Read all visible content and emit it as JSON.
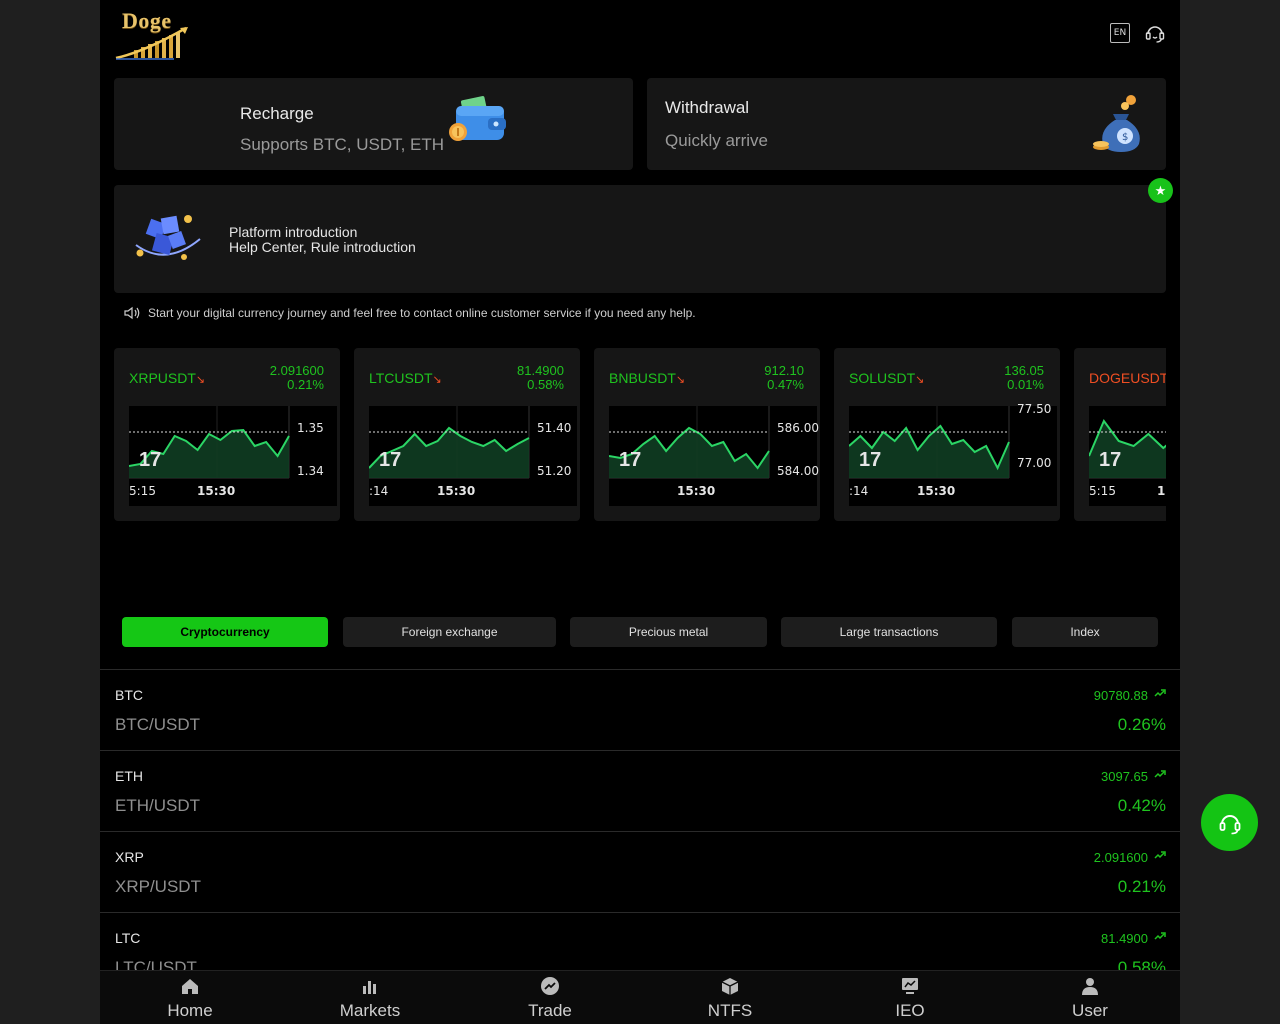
{
  "header": {
    "logo_text": "Doge",
    "language_label": "EN",
    "colors": {
      "accent": "#15c715",
      "down": "#ef4e23",
      "background": "#000000"
    }
  },
  "cards": {
    "recharge": {
      "title": "Recharge",
      "subtitle": "Supports BTC, USDT, ETH",
      "icon": "wallet-icon"
    },
    "withdraw": {
      "title": "Withdrawal",
      "subtitle": "Quickly arrive",
      "icon": "money-bag-icon"
    },
    "platform": {
      "title": "Platform introduction",
      "subtitle": "Help Center, Rule introduction",
      "icon": "cube-icon"
    }
  },
  "notice": {
    "text": "Start your digital currency journey and feel free to contact online customer service if you need any help.",
    "icon": "speaker-icon"
  },
  "tickers": [
    {
      "symbol": "XRPUSDT",
      "price": "2.091600",
      "change": "0.21%",
      "direction": "up",
      "axis_labels": [
        "1.35",
        "1.34"
      ],
      "time_labels": [
        "5:15",
        "15:30"
      ]
    },
    {
      "symbol": "LTCUSDT",
      "price": "81.4900",
      "change": "0.58%",
      "direction": "up",
      "axis_labels": [
        "51.40",
        "51.20"
      ],
      "time_labels": [
        ":14",
        "15:30"
      ]
    },
    {
      "symbol": "BNBUSDT",
      "price": "912.10",
      "change": "0.47%",
      "direction": "up",
      "axis_labels": [
        "586.00",
        "584.00"
      ],
      "time_labels": [
        "",
        "15:30"
      ]
    },
    {
      "symbol": "SOLUSDT",
      "price": "136.05",
      "change": "0.01%",
      "direction": "up",
      "axis_labels": [
        "77.50",
        "77.00"
      ],
      "time_labels": [
        ":14",
        "15:30"
      ]
    },
    {
      "symbol": "DOGEUSDT",
      "price": "",
      "change": "",
      "direction": "down",
      "axis_labels": [],
      "time_labels": [
        "5:15",
        "1"
      ]
    }
  ],
  "tabs": [
    {
      "label": "Cryptocurrency",
      "active": true
    },
    {
      "label": "Foreign exchange",
      "active": false
    },
    {
      "label": "Precious metal",
      "active": false
    },
    {
      "label": "Large transactions",
      "active": false
    },
    {
      "label": "Index",
      "active": false
    }
  ],
  "markets": [
    {
      "symbol": "BTC",
      "pair": "BTC/USDT",
      "price": "90780.88",
      "change": "0.26%"
    },
    {
      "symbol": "ETH",
      "pair": "ETH/USDT",
      "price": "3097.65",
      "change": "0.42%"
    },
    {
      "symbol": "XRP",
      "pair": "XRP/USDT",
      "price": "2.091600",
      "change": "0.21%"
    },
    {
      "symbol": "LTC",
      "pair": "LTC/USDT",
      "price": "81.4900",
      "change": "0.58%"
    }
  ],
  "nav": [
    {
      "label": "Home",
      "icon": "home-icon"
    },
    {
      "label": "Markets",
      "icon": "bar-chart-icon"
    },
    {
      "label": "Trade",
      "icon": "trend-icon"
    },
    {
      "label": "NTFS",
      "icon": "box-icon"
    },
    {
      "label": "IEO",
      "icon": "monitor-chart-icon"
    },
    {
      "label": "User",
      "icon": "user-icon"
    }
  ]
}
